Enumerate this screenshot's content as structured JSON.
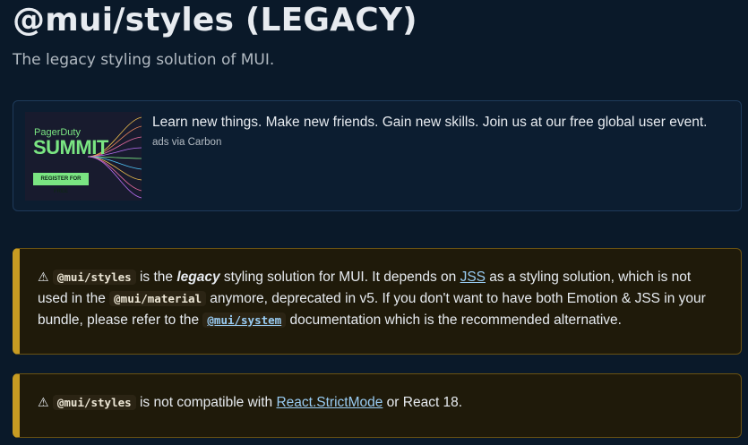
{
  "header": {
    "title": "@mui/styles (LEGACY)",
    "subtitle": "The legacy styling solution of MUI."
  },
  "ad": {
    "image_brand": "PagerDuty",
    "image_headline": "SUMMIT",
    "image_cta": "REGISTER FOR FREE",
    "text": "Learn new things. Make new friends. Gain new skills. Join us at our free global user event.",
    "via": "ads via Carbon"
  },
  "callout1": {
    "icon": "⚠",
    "code1": "@mui/styles",
    "t1": " is the ",
    "emph": "legacy",
    "t2": " styling solution for MUI. It depends on ",
    "link1": "JSS",
    "t3": " as a styling solution, which is not used in the ",
    "code2": "@mui/material",
    "t4": " anymore, deprecated in v5. If you don't want to have both Emotion & JSS in your bundle, please refer to the ",
    "link2": "@mui/system",
    "t5": " documentation which is the recommended alternative."
  },
  "callout2": {
    "icon": "⚠",
    "code1": "@mui/styles",
    "t1": " is not compatible with ",
    "link1": "React.StrictMode",
    "t2": " or React 18."
  }
}
